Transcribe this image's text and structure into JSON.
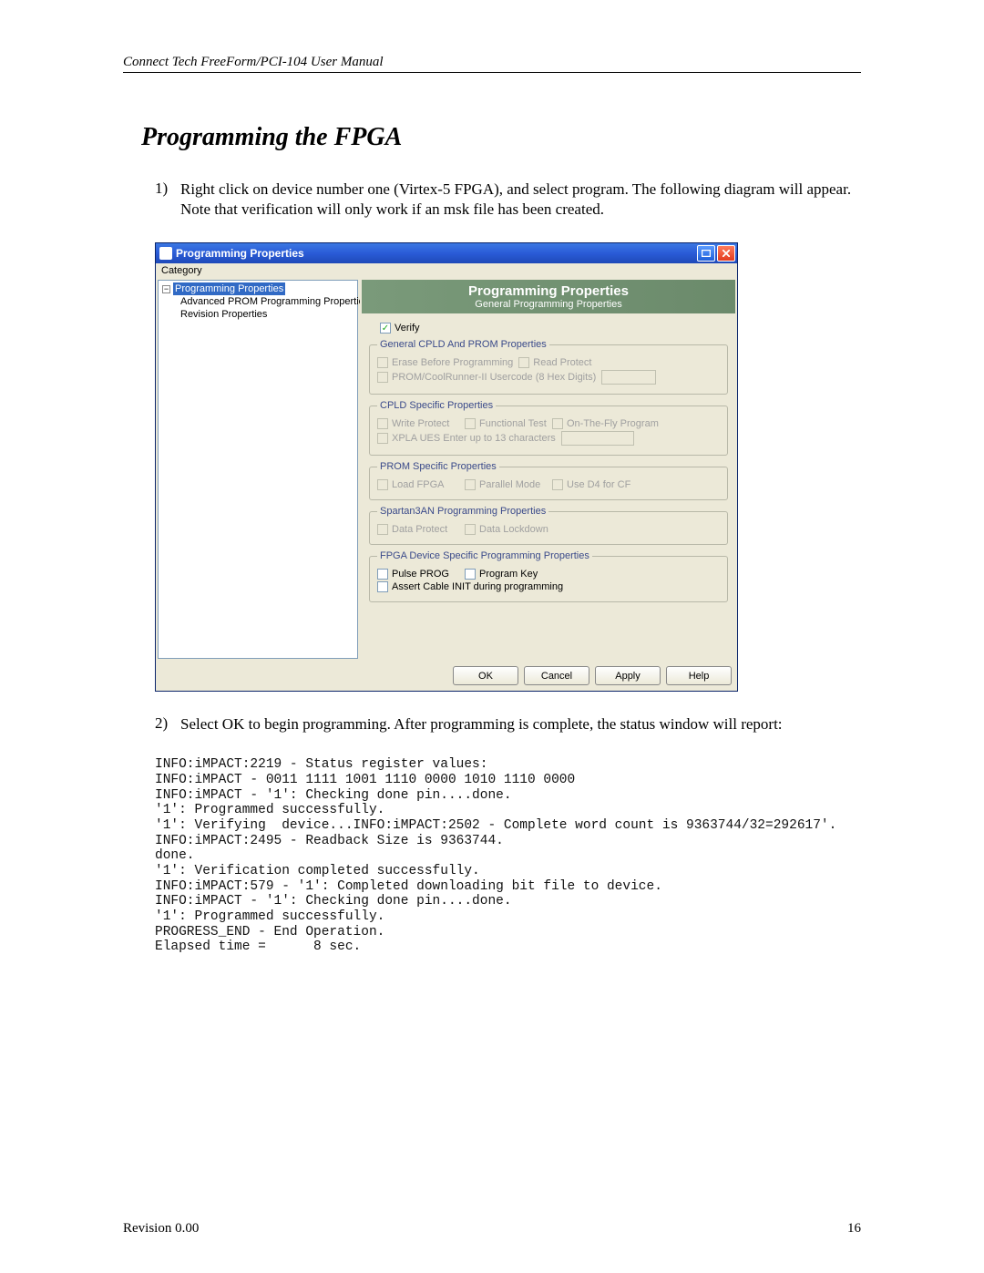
{
  "header": {
    "manual_title": "Connect Tech FreeForm/PCI-104 User Manual"
  },
  "section": {
    "title": "Programming the FPGA"
  },
  "steps": {
    "one_num": "1)",
    "one_text": "Right click on device number one (Virtex-5 FPGA), and select program.  The following diagram will appear.  Note that verification will only work if an msk file has been created.",
    "two_num": "2)",
    "two_text": "Select OK to begin programming.  After programming is complete, the status window will report:"
  },
  "dialog": {
    "title": "Programming Properties",
    "category_label": "Category",
    "tree": {
      "root": "Programming Properties",
      "child1": "Advanced PROM Programming Properties",
      "child2": "Revision Properties"
    },
    "panel_title": "Programming Properties",
    "panel_sub": "General Programming Properties",
    "verify": "Verify",
    "g1": {
      "legend": "General CPLD And PROM Properties",
      "erase": "Erase Before Programming",
      "readp": "Read Protect",
      "usercode": "PROM/CoolRunner-II Usercode (8 Hex Digits)"
    },
    "g2": {
      "legend": "CPLD Specific Properties",
      "writep": "Write Protect",
      "func": "Functional Test",
      "otf": "On-The-Fly Program",
      "xpla": "XPLA UES Enter up to 13 characters"
    },
    "g3": {
      "legend": "PROM Specific Properties",
      "load": "Load FPGA",
      "par": "Parallel Mode",
      "d4": "Use D4 for CF"
    },
    "g4": {
      "legend": "Spartan3AN Programming Properties",
      "dp": "Data Protect",
      "dl": "Data Lockdown"
    },
    "g5": {
      "legend": "FPGA Device Specific Programming Properties",
      "pulse": "Pulse PROG",
      "pkey": "Program Key",
      "assert": "Assert Cable INIT during programming"
    },
    "buttons": {
      "ok": "OK",
      "cancel": "Cancel",
      "apply": "Apply",
      "help": "Help"
    }
  },
  "log_text": "INFO:iMPACT:2219 - Status register values:\nINFO:iMPACT - 0011 1111 1001 1110 0000 1010 1110 0000\nINFO:iMPACT - '1': Checking done pin....done.\n'1': Programmed successfully.\n'1': Verifying  device...INFO:iMPACT:2502 - Complete word count is 9363744/32=292617'.\nINFO:iMPACT:2495 - Readback Size is 9363744.\ndone.\n'1': Verification completed successfully.\nINFO:iMPACT:579 - '1': Completed downloading bit file to device.\nINFO:iMPACT - '1': Checking done pin....done.\n'1': Programmed successfully.\nPROGRESS_END - End Operation.\nElapsed time =      8 sec.",
  "footer": {
    "revision": "Revision 0.00",
    "page": "16"
  }
}
